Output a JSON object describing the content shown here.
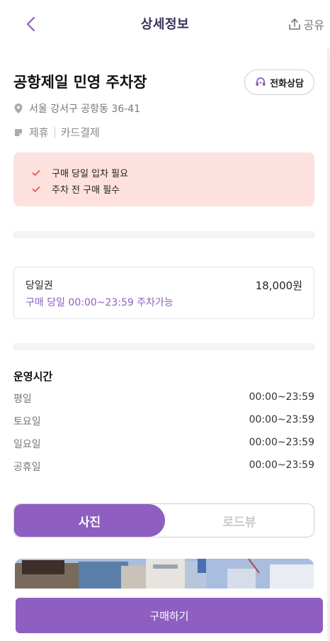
{
  "header": {
    "title": "상세정보",
    "share_label": "공유"
  },
  "lot": {
    "name": "공항제일 민영 주차장",
    "call_label": "전화상담",
    "address": "서울 강서구 공항동 36-41",
    "tags": [
      "제휴",
      "카드결제"
    ]
  },
  "notices": [
    "구매 당일 입차 필요",
    "주차 전 구매 필수"
  ],
  "ticket": {
    "name": "당일권",
    "price": "18,000원",
    "description": "구매 당일 00:00~23:59 주차가능"
  },
  "hours": {
    "title": "운영시간",
    "rows": [
      {
        "day": "평일",
        "time": "00:00~23:59"
      },
      {
        "day": "토요일",
        "time": "00:00~23:59"
      },
      {
        "day": "일요일",
        "time": "00:00~23:59"
      },
      {
        "day": "공휴일",
        "time": "00:00~23:59"
      }
    ]
  },
  "view_toggle": {
    "active": "사진",
    "inactive": "로드뷰"
  },
  "buy_label": "구매하기",
  "colors": {
    "accent": "#8e5fc0",
    "notice_bg": "#fde1de",
    "check": "#d9534f"
  }
}
